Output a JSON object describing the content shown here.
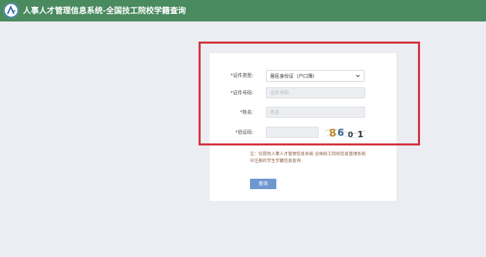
{
  "header": {
    "title": "人事人才管理信息系统-全国技工院校学籍查询",
    "accent_color": "#4a8a5f",
    "logo_icon": "logo-icon"
  },
  "form": {
    "id_type": {
      "label_required": "*",
      "label": "证件类型:",
      "selected": "居民身份证（户口簿）",
      "icon": "chevron-down-icon"
    },
    "id_number": {
      "label_required": "*",
      "label": "证件号码:",
      "placeholder": "证件号码",
      "value": ""
    },
    "name": {
      "label_required": "*",
      "label": "姓名:",
      "placeholder": "姓名",
      "value": ""
    },
    "captcha": {
      "label_required": "*",
      "label": "验证码:",
      "value": "",
      "image_text": "8601"
    },
    "note": "注：仅提供人事人才管理信息系统-全国技工院校信息管理系统中注册的学生学籍信息查询",
    "submit_label": "查询",
    "submit_color": "#6f96cf"
  },
  "annotation": {
    "color": "#d2333d"
  }
}
